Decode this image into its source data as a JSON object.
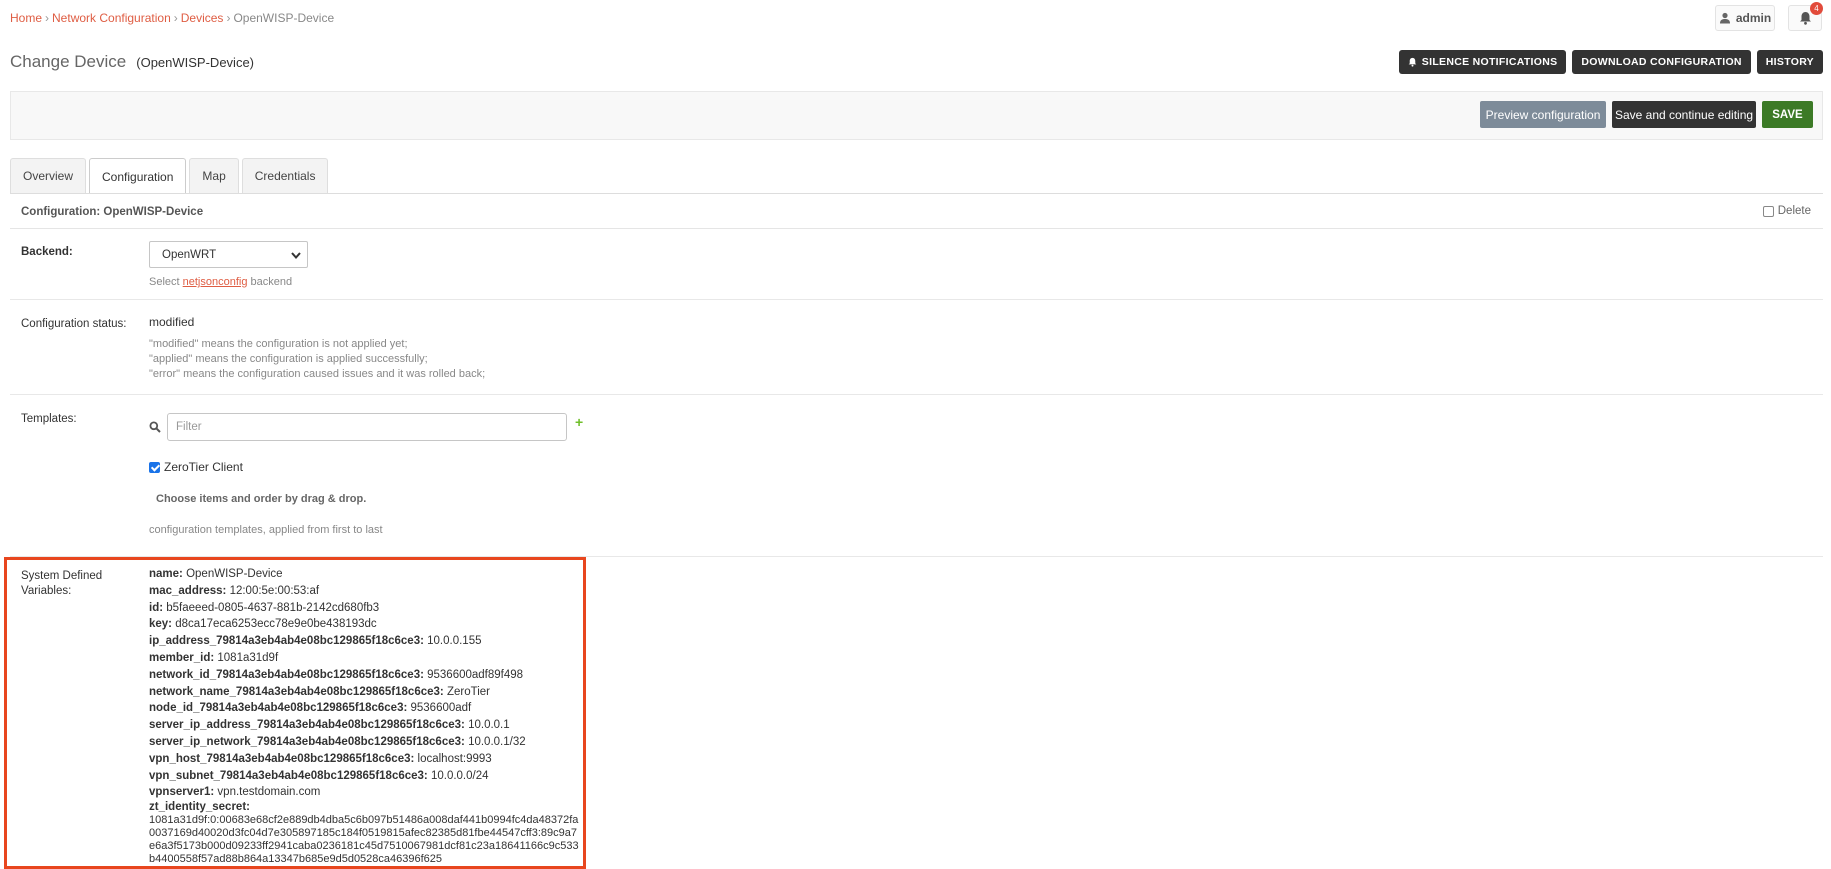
{
  "breadcrumb": {
    "home": "Home",
    "network_configuration": "Network Configuration",
    "devices": "Devices",
    "current": "OpenWISP-Device",
    "separator": "›"
  },
  "user": {
    "name": "admin",
    "notification_count": "4"
  },
  "page": {
    "title": "Change Device",
    "object_name": "(OpenWISP-Device)"
  },
  "object_tools": {
    "silence": "SILENCE NOTIFICATIONS",
    "download": "DOWNLOAD CONFIGURATION",
    "history": "HISTORY"
  },
  "submit": {
    "preview": "Preview configuration",
    "save_continue": "Save and continue editing",
    "save": "SAVE"
  },
  "tabs": [
    {
      "label": "Overview",
      "active": false
    },
    {
      "label": "Configuration",
      "active": true
    },
    {
      "label": "Map",
      "active": false
    },
    {
      "label": "Credentials",
      "active": false
    }
  ],
  "config": {
    "header": "Configuration: OpenWISP-Device",
    "delete_label": "Delete",
    "backend": {
      "label": "Backend:",
      "value": "OpenWRT",
      "help_prefix": "Select",
      "help_link": "netjsonconfig",
      "help_suffix": "backend"
    },
    "status": {
      "label": "Configuration status:",
      "value": "modified",
      "help": [
        "\"modified\" means the configuration is not applied yet;",
        "\"applied\" means the configuration is applied successfully;",
        "\"error\" means the configuration caused issues and it was rolled back;"
      ]
    },
    "templates": {
      "label": "Templates:",
      "filter_placeholder": "Filter",
      "item": "ZeroTier Client",
      "drag_hint": "Choose items and order by drag & drop.",
      "help": "configuration templates, applied from first to last"
    },
    "system_vars": {
      "label_line1": "System Defined",
      "label_line2": "Variables:",
      "items": [
        {
          "key": "name:",
          "value": "OpenWISP-Device"
        },
        {
          "key": "mac_address:",
          "value": "12:00:5e:00:53:af"
        },
        {
          "key": "id:",
          "value": "b5faeeed-0805-4637-881b-2142cd680fb3"
        },
        {
          "key": "key:",
          "value": "d8ca17eca6253ecc78e9e0be438193dc"
        },
        {
          "key": "ip_address_79814a3eb4ab4e08bc129865f18c6ce3:",
          "value": "10.0.0.155"
        },
        {
          "key": "member_id:",
          "value": "1081a31d9f"
        },
        {
          "key": "network_id_79814a3eb4ab4e08bc129865f18c6ce3:",
          "value": "9536600adf89f498"
        },
        {
          "key": "network_name_79814a3eb4ab4e08bc129865f18c6ce3:",
          "value": "ZeroTier"
        },
        {
          "key": "node_id_79814a3eb4ab4e08bc129865f18c6ce3:",
          "value": "9536600adf"
        },
        {
          "key": "server_ip_address_79814a3eb4ab4e08bc129865f18c6ce3:",
          "value": "10.0.0.1"
        },
        {
          "key": "server_ip_network_79814a3eb4ab4e08bc129865f18c6ce3:",
          "value": "10.0.0.1/32"
        },
        {
          "key": "vpn_host_79814a3eb4ab4e08bc129865f18c6ce3:",
          "value": "localhost:9993"
        },
        {
          "key": "vpn_subnet_79814a3eb4ab4e08bc129865f18c6ce3:",
          "value": "10.0.0.0/24"
        },
        {
          "key": "vpnserver1:",
          "value": "vpn.testdomain.com"
        }
      ],
      "secret_key": "zt_identity_secret:",
      "secret_value": "1081a31d9f:0:00683e68cf2e889db4dba5c6b097b51486a008daf441b0994fc4da48372fa0037169d40020d3fc04d7e305897185c184f0519815afec82385d81fbe44547cff3:89c9a7e6a3f5173b000d09233ff2941caba0236181c45d7510067981dcf81c23a18641166c9c533b4400558f57ad88b864a13347b685e9d5d0528ca46396f625"
    }
  },
  "colors": {
    "accent": "#df5d43",
    "dark_button": "#333333",
    "save_button": "#3c7a26",
    "preview_button": "#7d8b99",
    "highlight_border": "#e8461e",
    "badge": "#e24b3b"
  }
}
